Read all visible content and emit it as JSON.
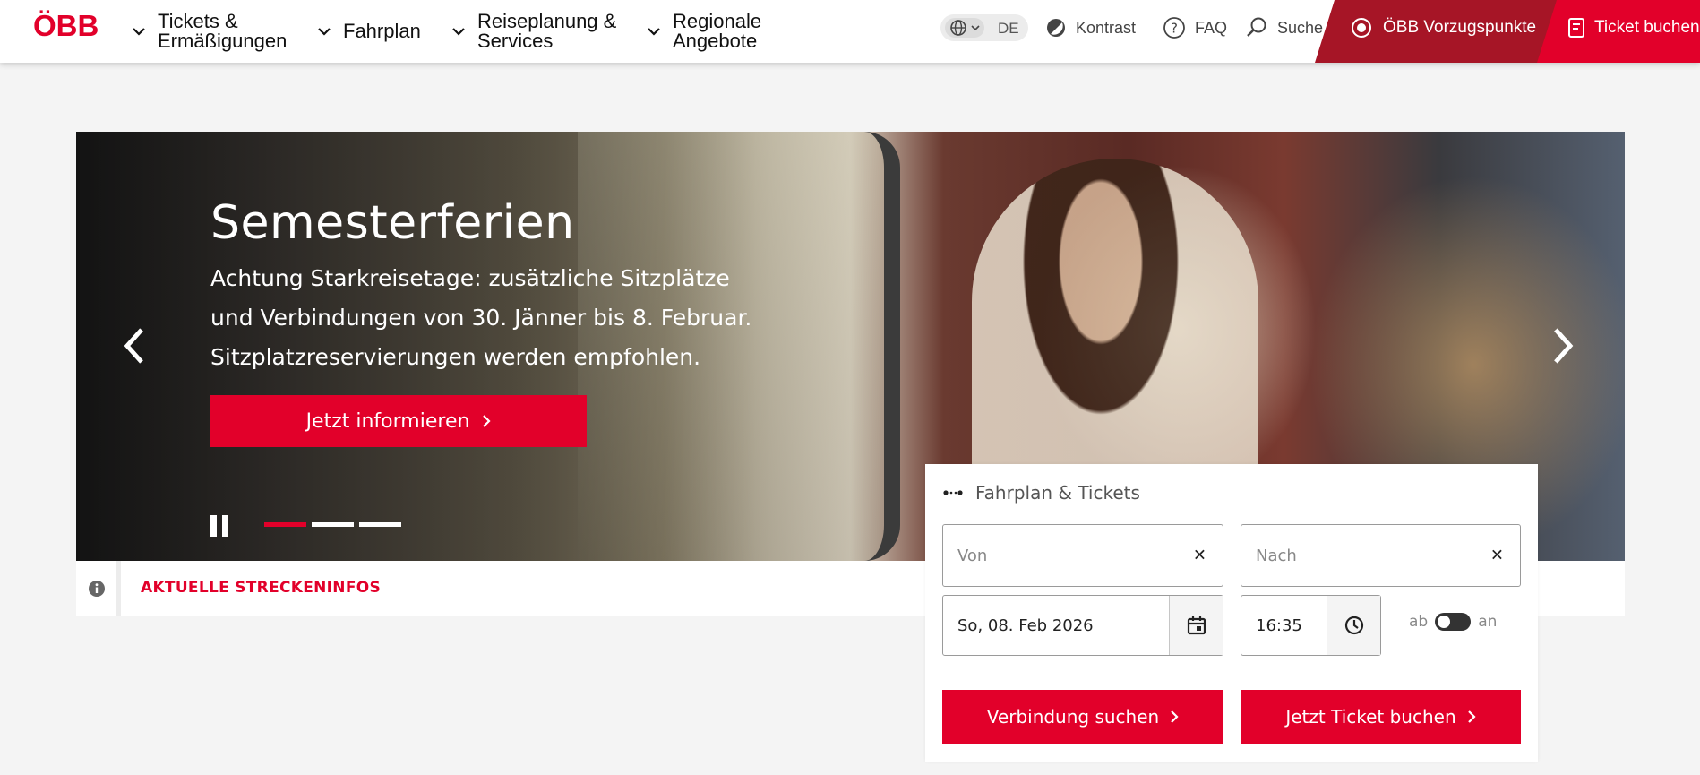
{
  "header": {
    "logo_text": "ÖBB",
    "nav": [
      {
        "label": "Tickets &\nErmäßigungen"
      },
      {
        "label": "Fahrplan"
      },
      {
        "label": "Reiseplanung &\nServices"
      },
      {
        "label": "Regionale\nAngebote"
      }
    ],
    "language": "DE",
    "contrast_label": "Kontrast",
    "faq_label": "FAQ",
    "search_label": "Suche",
    "vorzugspunkte_label": "ÖBB Vorzugspunkte",
    "ticket_label": "Ticket buchen"
  },
  "hero": {
    "title": "Semesterferien",
    "text": "Achtung Starkreisetage: zusätzliche Sitzplätze und Verbindungen von 30. Jänner bis 8. Februar. Sitzplatzreservierungen werden empfohlen.",
    "cta_label": "Jetzt informieren",
    "slide_count": 3,
    "active_slide": 1
  },
  "infobar": {
    "label": "AKTUELLE STRECKENINFOS"
  },
  "booking": {
    "title": "Fahrplan & Tickets",
    "from_placeholder": "Von",
    "to_placeholder": "Nach",
    "date": "So, 08. Feb 2026",
    "time": "16:35",
    "toggle_left": "ab",
    "toggle_right": "an",
    "search_button": "Verbindung suchen",
    "book_button": "Jetzt Ticket buchen"
  },
  "colors": {
    "brand_red": "#e2002a",
    "dark_red": "#a61526"
  }
}
